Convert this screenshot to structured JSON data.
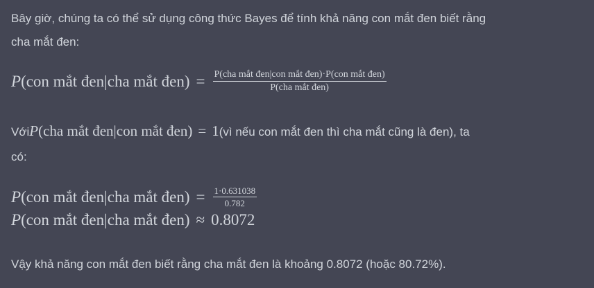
{
  "intro": {
    "line1": "Bây giờ, chúng ta có thể sử dụng công thức Bayes để tính khả năng con mắt đen biết rằng",
    "line2": "cha mắt đen:"
  },
  "formula1": {
    "lhs_var": "P",
    "lhs_arg": "(con mắt đen|cha mắt đen)",
    "rel": "=",
    "numerator": "P(cha mắt đen|con mắt đen)·P(con mắt đen)",
    "denominator": "P(cha mắt đen)"
  },
  "given": {
    "prefix": "Với ",
    "math_var": "P",
    "math_arg": "(cha mắt đen|con mắt đen)",
    "math_rel": "=",
    "math_value": "1",
    "suffix": " (vì nếu con mắt đen thì cha mắt cũng là đen), ta",
    "line2": "có:"
  },
  "formula2": {
    "lhs_var": "P",
    "lhs_arg": "(con mắt đen|cha mắt đen)",
    "rel": "=",
    "numerator": "1·0.631038",
    "denominator": "0.782"
  },
  "formula3": {
    "lhs_var": "P",
    "lhs_arg": "(con mắt đen|cha mắt đen)",
    "rel": "≈",
    "value": "0.8072"
  },
  "conclusion": "Vậy khả năng con mắt đen biết rằng cha mắt đen là khoảng 0.8072 (hoặc 80.72%).",
  "colors": {
    "background": "#444654",
    "text": "#d1d5db"
  }
}
